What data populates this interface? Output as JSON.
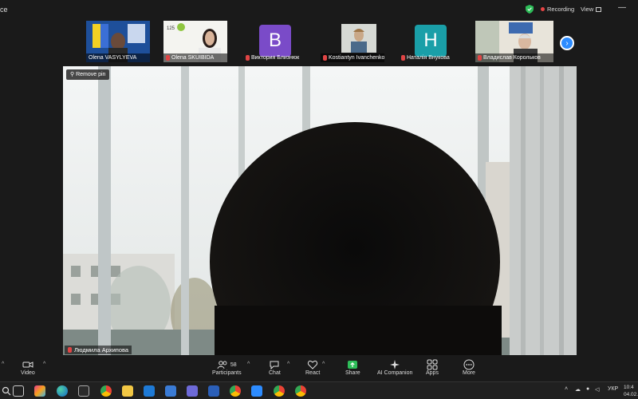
{
  "window": {
    "title_partial": "ce"
  },
  "top_bar": {
    "recording_label": "Recording",
    "view_label": "View",
    "minimize_glyph": "—",
    "colors": {
      "recording_dot": "#e84545",
      "shield": "#2ebd59"
    }
  },
  "participants_strip": {
    "tiles": [
      {
        "name": "Olena VASYLYEVA",
        "muted": false,
        "kind": "video"
      },
      {
        "name": "Olena SKUIBIDA",
        "muted": true,
        "kind": "video"
      },
      {
        "name": "Виктория Близнюк",
        "muted": true,
        "kind": "avatar",
        "initial": "B",
        "color": "#7a4bc8"
      },
      {
        "name": "Kostiantyn Ivanchenko",
        "muted": true,
        "kind": "video"
      },
      {
        "name": "Наталія Внукова",
        "muted": true,
        "kind": "avatar",
        "initial": "H",
        "color": "#1a9fa8"
      },
      {
        "name": "Владислав Корольков",
        "muted": true,
        "kind": "video"
      }
    ],
    "next_page_icon": "chevron-right-icon"
  },
  "main_video": {
    "pin_label": "Remove pin",
    "speaker_name": "Людмила Архипова",
    "speaker_muted": true
  },
  "toolbar": {
    "audio_glyph": "^",
    "video_label": "Video",
    "participants_label": "Participants",
    "participants_count": "58",
    "chat_label": "Chat",
    "react_label": "React",
    "share_label": "Share",
    "ai_label": "AI Companion",
    "apps_label": "Apps",
    "more_label": "More",
    "colors": {
      "share": "#2ebd59"
    }
  },
  "taskbar": {
    "lang": "УКР",
    "time_partial": "10:4",
    "date_partial": "04.02."
  }
}
